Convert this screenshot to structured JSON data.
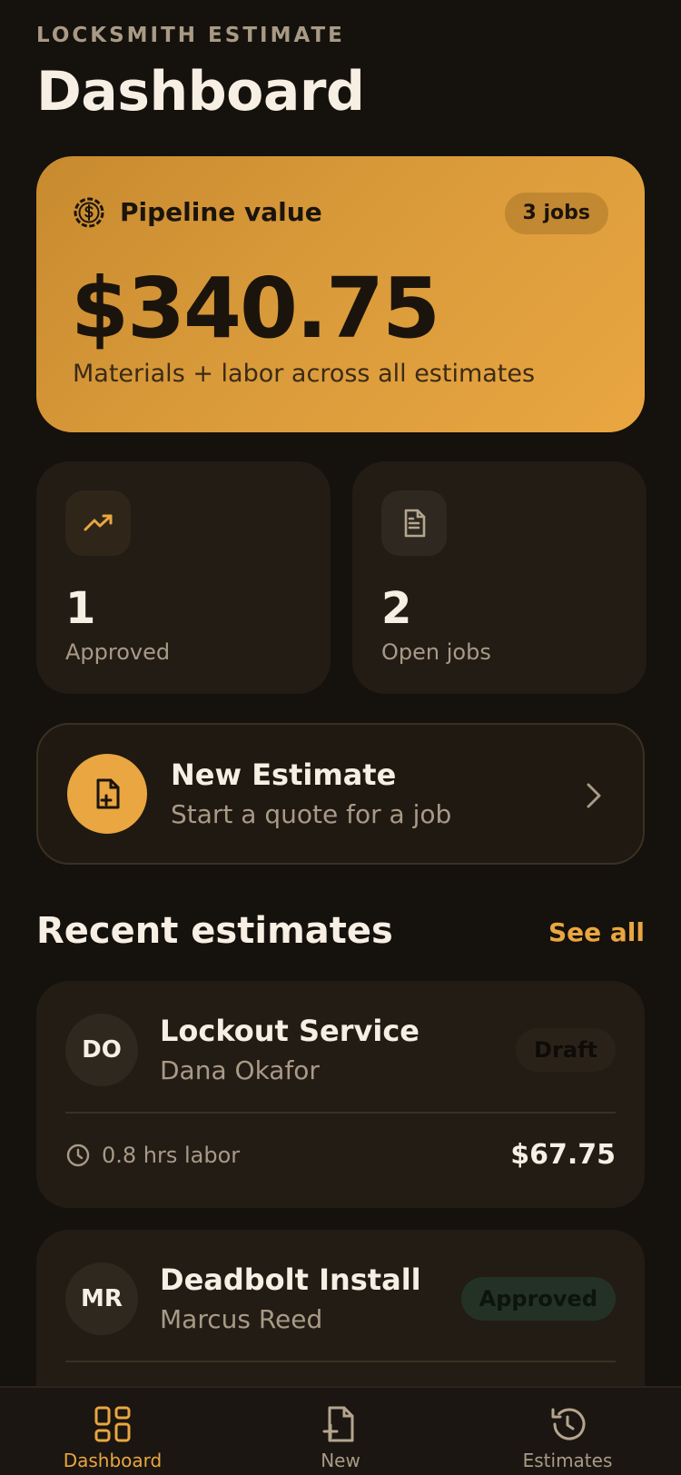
{
  "header": {
    "eyebrow": "LOCKSMITH ESTIMATE",
    "title": "Dashboard"
  },
  "pipeline": {
    "label": "Pipeline value",
    "jobs_badge": "3 jobs",
    "amount": "$340.75",
    "subtitle": "Materials + labor across all estimates",
    "icon": "dollar-circle-icon"
  },
  "stats": [
    {
      "value": "1",
      "label": "Approved",
      "icon": "trending-up-icon"
    },
    {
      "value": "2",
      "label": "Open jobs",
      "icon": "document-icon"
    }
  ],
  "new_estimate": {
    "title": "New Estimate",
    "subtitle": "Start a quote for a job",
    "icon": "file-plus-icon"
  },
  "recent": {
    "title": "Recent estimates",
    "see_all": "See all",
    "items": [
      {
        "initials": "DO",
        "title": "Lockout Service",
        "client": "Dana Okafor",
        "status": "Draft",
        "labor": "0.8 hrs labor",
        "price": "$67.75"
      },
      {
        "initials": "MR",
        "title": "Deadbolt Install",
        "client": "Marcus Reed",
        "status": "Approved",
        "labor": "",
        "price": ""
      }
    ]
  },
  "tabbar": {
    "tabs": [
      {
        "label": "Dashboard",
        "icon": "grid-icon",
        "active": true
      },
      {
        "label": "New",
        "icon": "file-plus-icon",
        "active": false
      },
      {
        "label": "Estimates",
        "icon": "history-icon",
        "active": false
      }
    ]
  },
  "colors": {
    "background": "#15110c",
    "accent": "#e9a641",
    "card": "#221c15",
    "muted_text": "#a99a86"
  }
}
